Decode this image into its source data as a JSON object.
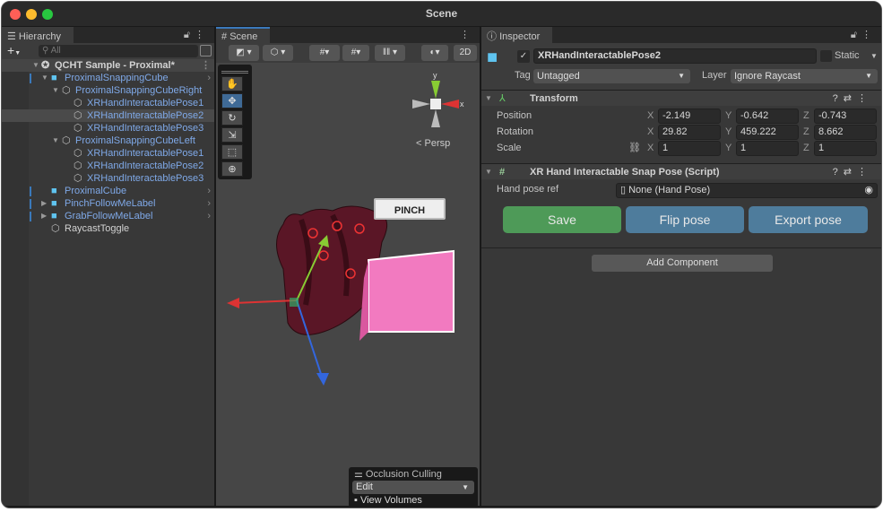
{
  "window": {
    "title": "Scene"
  },
  "hierarchy": {
    "tab": "Hierarchy",
    "search_placeholder": "All",
    "root": "QCHT Sample - Proximal*",
    "items": [
      {
        "label": "ProximalSnappingCube",
        "level": 1,
        "prefab": true,
        "expanded": true
      },
      {
        "label": "ProximalSnappingCubeRight",
        "level": 2,
        "prefab": false,
        "expanded": true
      },
      {
        "label": "XRHandInteractablePose1",
        "level": 3
      },
      {
        "label": "XRHandInteractablePose2",
        "level": 3,
        "selected": true
      },
      {
        "label": "XRHandInteractablePose3",
        "level": 3
      },
      {
        "label": "ProximalSnappingCubeLeft",
        "level": 2,
        "expanded": true
      },
      {
        "label": "XRHandInteractablePose1",
        "level": 3
      },
      {
        "label": "XRHandInteractablePose2",
        "level": 3
      },
      {
        "label": "XRHandInteractablePose3",
        "level": 3
      },
      {
        "label": "ProximalCube",
        "level": 1,
        "prefab": true
      },
      {
        "label": "PinchFollowMeLabel",
        "level": 1,
        "prefab": true,
        "collapsed": true
      },
      {
        "label": "GrabFollowMeLabel",
        "level": 1,
        "prefab": true,
        "collapsed": true
      },
      {
        "label": "RaycastToggle",
        "level": 1,
        "plain": true
      }
    ]
  },
  "scene": {
    "tab": "Scene",
    "mode_2d": "2D",
    "persp": "Persp",
    "axis_y": "y",
    "axis_x": "x",
    "pinch_label": "PINCH",
    "occlusion": {
      "title": "Occlusion Culling",
      "mode": "Edit",
      "view_volumes": "View Volumes"
    }
  },
  "inspector": {
    "tab": "Inspector",
    "object_name": "XRHandInteractablePose2",
    "static_label": "Static",
    "tag_label": "Tag",
    "tag": "Untagged",
    "layer_label": "Layer",
    "layer": "Ignore Raycast",
    "transform": {
      "title": "Transform",
      "position": {
        "label": "Position",
        "x": "-2.149",
        "y": "-0.642",
        "z": "-0.743"
      },
      "rotation": {
        "label": "Rotation",
        "x": "29.82",
        "y": "459.222",
        "z": "8.662"
      },
      "scale": {
        "label": "Scale",
        "x": "1",
        "y": "1",
        "z": "1"
      }
    },
    "script": {
      "title": "XR Hand Interactable Snap Pose (Script)",
      "hand_pose_label": "Hand pose ref",
      "hand_pose_value": "None (Hand Pose)"
    },
    "buttons": {
      "save": "Save",
      "flip": "Flip pose",
      "export": "Export pose"
    },
    "add_component": "Add Component"
  },
  "colors": {
    "save": "#4e9a58",
    "flip": "#4e7c9c",
    "export": "#4e7c9c",
    "link": "#7fa9e8",
    "selection": "#4a4a4a",
    "cube": "#f27ac0"
  }
}
